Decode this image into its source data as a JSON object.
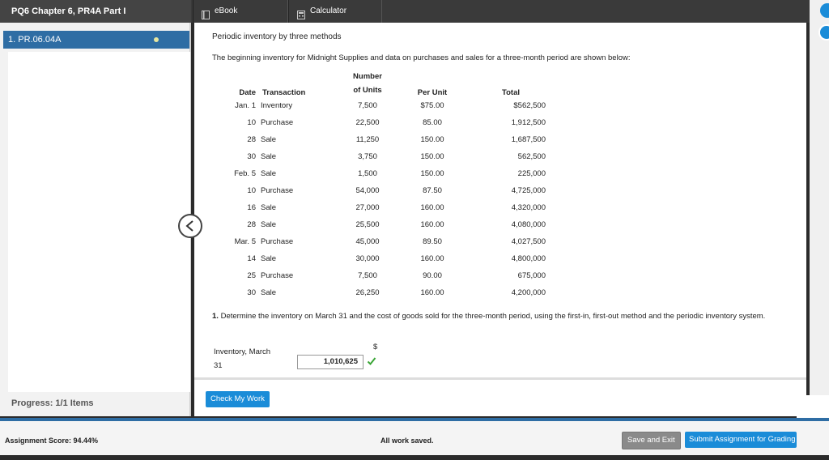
{
  "header": {
    "app_title": "PQ6 Chapter 6, PR4A Part I",
    "tabs": [
      {
        "label": "eBook",
        "icon": "ebook-icon"
      },
      {
        "label": "Calculator",
        "icon": "calculator-icon"
      }
    ]
  },
  "sidebar": {
    "items": [
      {
        "label": "1. PR.06.04A",
        "active": true
      }
    ],
    "progress": "Progress: 1/1 Items"
  },
  "main": {
    "heading": "Periodic inventory by three methods",
    "intro": "The beginning inventory for Midnight Supplies and data on purchases and sales for a three-month period are shown below:",
    "table": {
      "headers": {
        "date": "Date",
        "transaction": "Transaction",
        "units_line1": "Number",
        "units_line2": "of Units",
        "per_unit": "Per Unit",
        "total": "Total"
      },
      "rows": [
        {
          "date": "Jan. 1",
          "transaction": "Inventory",
          "units": "7,500",
          "per_unit": "$75.00",
          "total": "$562,500"
        },
        {
          "date": "10",
          "transaction": "Purchase",
          "units": "22,500",
          "per_unit": "85.00",
          "total": "1,912,500"
        },
        {
          "date": "28",
          "transaction": "Sale",
          "units": "11,250",
          "per_unit": "150.00",
          "total": "1,687,500"
        },
        {
          "date": "30",
          "transaction": "Sale",
          "units": "3,750",
          "per_unit": "150.00",
          "total": "562,500"
        },
        {
          "date": "Feb. 5",
          "transaction": "Sale",
          "units": "1,500",
          "per_unit": "150.00",
          "total": "225,000"
        },
        {
          "date": "10",
          "transaction": "Purchase",
          "units": "54,000",
          "per_unit": "87.50",
          "total": "4,725,000"
        },
        {
          "date": "16",
          "transaction": "Sale",
          "units": "27,000",
          "per_unit": "160.00",
          "total": "4,320,000"
        },
        {
          "date": "28",
          "transaction": "Sale",
          "units": "25,500",
          "per_unit": "160.00",
          "total": "4,080,000"
        },
        {
          "date": "Mar. 5",
          "transaction": "Purchase",
          "units": "45,000",
          "per_unit": "89.50",
          "total": "4,027,500"
        },
        {
          "date": "14",
          "transaction": "Sale",
          "units": "30,000",
          "per_unit": "160.00",
          "total": "4,800,000"
        },
        {
          "date": "25",
          "transaction": "Purchase",
          "units": "7,500",
          "per_unit": "90.00",
          "total": "675,000"
        },
        {
          "date": "30",
          "transaction": "Sale",
          "units": "26,250",
          "per_unit": "160.00",
          "total": "4,200,000"
        }
      ]
    },
    "question": {
      "number": "1.",
      "text": "Determine the inventory on March 31 and the cost of goods sold for the three-month period, using the first-in, first-out method and the periodic inventory system."
    },
    "inventory": {
      "label_line1": "Inventory, March",
      "label_line2": "31",
      "currency": "$",
      "value": "1,010,625",
      "status": "correct"
    },
    "check_button": "Check My Work"
  },
  "footer": {
    "score": "Assignment Score: 94.44%",
    "save_status": "All work saved.",
    "save_exit": "Save and Exit",
    "submit": "Submit Assignment for Grading"
  },
  "colors": {
    "accent": "#2e6da4",
    "button_blue": "#1a8cd8",
    "correct_green": "#3aa536",
    "dark_bar": "#3a3a3a"
  }
}
